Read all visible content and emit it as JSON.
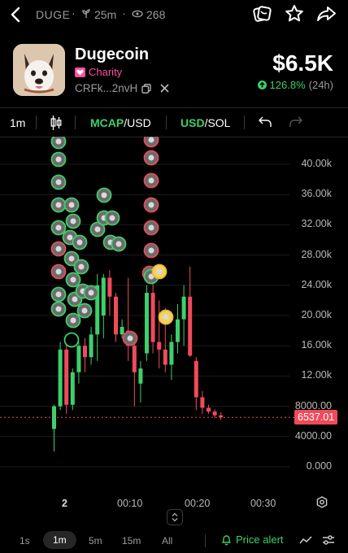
{
  "header": {
    "symbol": "DUGE",
    "age": "25m",
    "views": "268"
  },
  "token": {
    "name": "Dugecoin",
    "tag": "Charity",
    "address": "CRFk...2nvH",
    "price": "$6.5K",
    "change": "126.8%",
    "change_period": "(24h)"
  },
  "toolbar": {
    "interval": "1m",
    "pair1_a": "MCAP",
    "pair1_b": "/USD",
    "pair2_a": "USD",
    "pair2_b": "/SOL"
  },
  "chart_data": {
    "type": "candlestick",
    "y_ticks": [
      "40.00k",
      "36.00k",
      "32.00k",
      "28.00k",
      "24.00k",
      "20.00k",
      "16.00k",
      "12.00k",
      "8000.00",
      "4000.00",
      "0.000"
    ],
    "x_ticks": [
      "2",
      "00:10",
      "00:20",
      "00:30"
    ],
    "current_price_label": "6537.01",
    "ylim": [
      0,
      40000
    ],
    "candles": [
      {
        "o": 5000,
        "h": 8200,
        "l": 2000,
        "c": 8000
      },
      {
        "o": 8000,
        "h": 16500,
        "l": 7500,
        "c": 15500
      },
      {
        "o": 15500,
        "h": 16200,
        "l": 7000,
        "c": 8200
      },
      {
        "o": 8200,
        "h": 13000,
        "l": 7500,
        "c": 12500
      },
      {
        "o": 12500,
        "h": 16500,
        "l": 11000,
        "c": 16000
      },
      {
        "o": 16000,
        "h": 17000,
        "l": 12500,
        "c": 14500
      },
      {
        "o": 14500,
        "h": 18500,
        "l": 13500,
        "c": 17500
      },
      {
        "o": 17500,
        "h": 25500,
        "l": 14000,
        "c": 24000
      },
      {
        "o": 20000,
        "h": 25500,
        "l": 17000,
        "c": 25000
      },
      {
        "o": 25000,
        "h": 26000,
        "l": 20000,
        "c": 22500
      },
      {
        "o": 22500,
        "h": 23000,
        "l": 16500,
        "c": 17500
      },
      {
        "o": 17500,
        "h": 19500,
        "l": 17000,
        "c": 18500
      },
      {
        "o": 18000,
        "h": 25000,
        "l": 14000,
        "c": 16000
      },
      {
        "o": 16000,
        "h": 17500,
        "l": 8000,
        "c": 12500
      },
      {
        "o": 11000,
        "h": 14000,
        "l": 8500,
        "c": 13000
      },
      {
        "o": 15000,
        "h": 24000,
        "l": 14000,
        "c": 23000
      },
      {
        "o": 23000,
        "h": 25000,
        "l": 15000,
        "c": 16500
      },
      {
        "o": 16500,
        "h": 22000,
        "l": 13000,
        "c": 15500
      },
      {
        "o": 15500,
        "h": 21000,
        "l": 12500,
        "c": 13500
      },
      {
        "o": 13500,
        "h": 17500,
        "l": 11500,
        "c": 16500
      },
      {
        "o": 16500,
        "h": 21500,
        "l": 15000,
        "c": 19500
      },
      {
        "o": 19500,
        "h": 24000,
        "l": 16000,
        "c": 22500
      },
      {
        "o": 22500,
        "h": 26500,
        "l": 14500,
        "c": 14700
      },
      {
        "o": 14000,
        "h": 14500,
        "l": 7500,
        "c": 9200
      },
      {
        "o": 9200,
        "h": 10000,
        "l": 7000,
        "c": 7800
      },
      {
        "o": 7800,
        "h": 8200,
        "l": 7000,
        "c": 7300
      },
      {
        "o": 7300,
        "h": 7600,
        "l": 6500,
        "c": 6800
      },
      {
        "o": 6800,
        "h": 7200,
        "l": 6200,
        "c": 6537
      }
    ]
  },
  "timeframes": [
    "1s",
    "1m",
    "5m",
    "15m",
    "All"
  ],
  "bottom": {
    "price_alert": "Price alert"
  },
  "colors": {
    "up": "#3ecf6b",
    "down": "#f04a5b",
    "accent": "#3ecf6b"
  }
}
